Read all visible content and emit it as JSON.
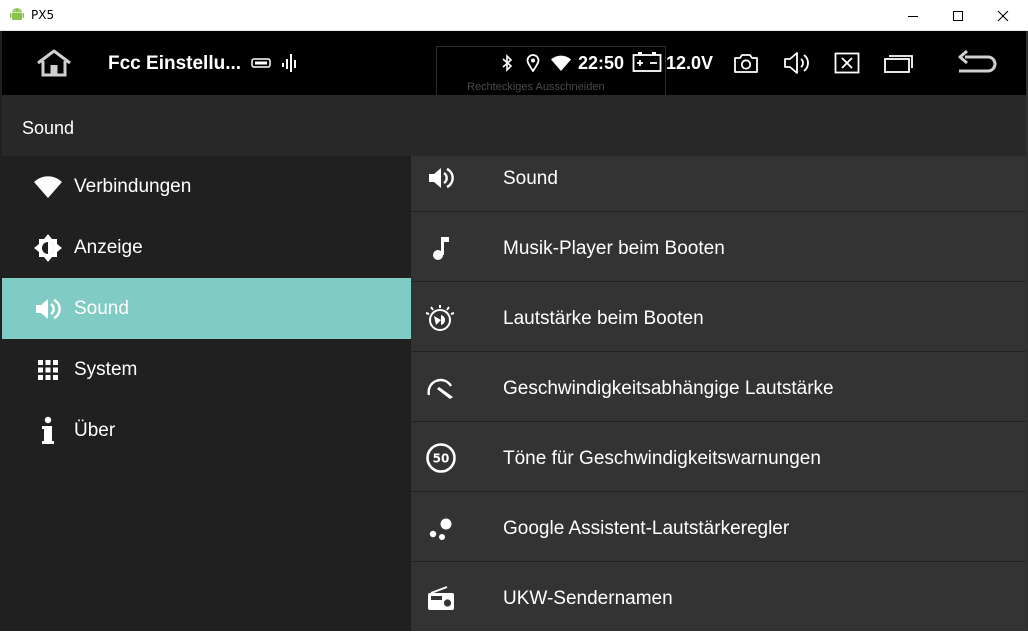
{
  "window": {
    "title": "PX5"
  },
  "status_bar": {
    "app_title": "Fcc Einstellu...",
    "time": "22:50",
    "voltage": "12.0V",
    "tooltip_ghost": "Rechteckiges Ausschneiden"
  },
  "header": {
    "title": "Sound"
  },
  "nav": {
    "items": [
      {
        "label": "Verbindungen",
        "icon": "wifi-icon"
      },
      {
        "label": "Anzeige",
        "icon": "brightness-icon"
      },
      {
        "label": "Sound",
        "icon": "volume-icon",
        "active": true
      },
      {
        "label": "System",
        "icon": "grid-icon"
      },
      {
        "label": "Über",
        "icon": "info-icon"
      }
    ]
  },
  "list": {
    "items": [
      {
        "label": "Sound",
        "icon": "volume-icon"
      },
      {
        "label": "Musik-Player beim Booten",
        "icon": "music-note-icon"
      },
      {
        "label": "Lautstärke beim Booten",
        "icon": "boot-volume-icon"
      },
      {
        "label": "Geschwindigkeitsabhängige Lautstärke",
        "icon": "speedometer-icon"
      },
      {
        "label": "Töne für Geschwindigkeitswarnungen",
        "icon": "speed-limit-icon",
        "icon_text": "50"
      },
      {
        "label": "Google Assistent-Lautstärkeregler",
        "icon": "assistant-icon"
      },
      {
        "label": "UKW-Sendernamen",
        "icon": "radio-icon"
      }
    ]
  },
  "colors": {
    "active_nav": "#80cbc4",
    "header_bg": "#282828",
    "nav_bg": "#202020",
    "list_bg": "#333333"
  }
}
